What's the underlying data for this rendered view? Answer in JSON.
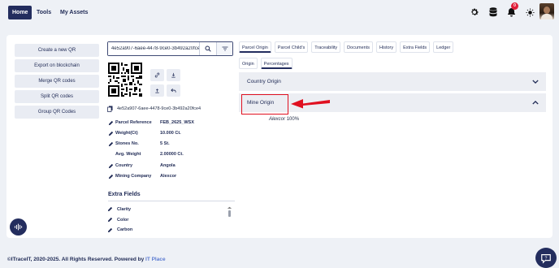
{
  "navbar": {
    "items": [
      {
        "label": "Home",
        "active": true
      },
      {
        "label": "Tools",
        "active": false
      },
      {
        "label": "My Assets",
        "active": false
      }
    ],
    "notification_count": "0",
    "icons": [
      "settings-gear-icon",
      "database-icon",
      "bell-icon",
      "sun-icon"
    ]
  },
  "left_actions": [
    {
      "label": "Create a new QR"
    },
    {
      "label": "Export on blockchain"
    },
    {
      "label": "Merge QR codes"
    },
    {
      "label": "Split QR codes"
    },
    {
      "label": "Group QR Codes"
    }
  ],
  "search": {
    "value": "4e52a907-6aee-4478-9ce0-3b492a20fce4"
  },
  "qr_id": "4e52a907-6aee-4478-9ce0-3b492a20fce4",
  "properties": [
    {
      "label": "Parcel Reference",
      "value": "FEB_2625_WSX",
      "icon": "pencil-icon"
    },
    {
      "label": "Weight(Ct)",
      "value": "10.000 Ct.",
      "icon": "pencil-icon"
    },
    {
      "label": "Stones No.",
      "value": "5 St.",
      "icon": "pencil-icon"
    },
    {
      "label": "Avg. Weight",
      "value": "2.00000 Ct.",
      "icon": ""
    },
    {
      "label": "Country",
      "value": "Angola",
      "icon": "pencil-icon"
    },
    {
      "label": "Mining Company",
      "value": "Alexcor",
      "icon": "pencil-icon"
    }
  ],
  "extra_fields": {
    "title": "Extra Fields",
    "items": [
      {
        "label": "Clarity"
      },
      {
        "label": "Color"
      },
      {
        "label": "Carbon"
      }
    ]
  },
  "tabs": [
    {
      "label": "Parcel Origin",
      "active": true
    },
    {
      "label": "Parcel Child's",
      "active": false
    },
    {
      "label": "Traceability",
      "active": false
    },
    {
      "label": "Documents",
      "active": false
    },
    {
      "label": "History",
      "active": false
    },
    {
      "label": "Extra Fields",
      "active": false
    },
    {
      "label": "Ledger",
      "active": false
    }
  ],
  "subtabs": [
    {
      "label": "Origin",
      "active": false
    },
    {
      "label": "Percentages",
      "active": true
    }
  ],
  "accordions": [
    {
      "label": "Country Origin",
      "expanded": false
    },
    {
      "label": "Mine Origin",
      "expanded": true
    }
  ],
  "mine_origin": {
    "name": "Alexcor",
    "percent": "100%"
  },
  "footer": {
    "text": "©ITraceIT, 2020-2025. All Rights Reserved. Powered by ",
    "brand": "IT Place"
  },
  "colors": {
    "primary": "#232d5e",
    "highlight": "#e01020",
    "badge": "#e0203a"
  }
}
